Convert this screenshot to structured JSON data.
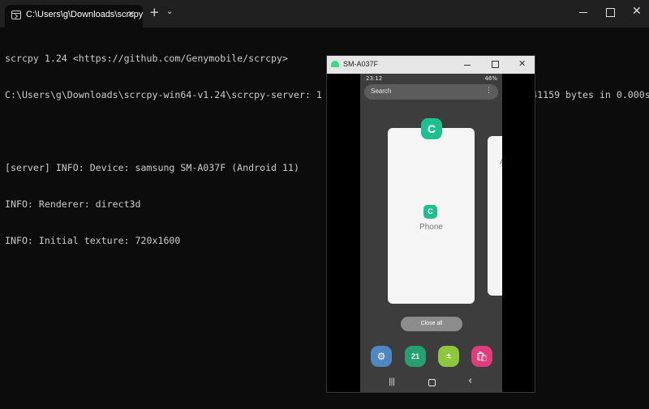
{
  "terminal": {
    "tab_title": "C:\\Users\\g\\Downloads\\scrcpy",
    "lines": [
      "scrcpy 1.24 <https://github.com/Genymobile/scrcpy>",
      "C:\\Users\\g\\Downloads\\scrcpy-win64-v1.24\\scrcpy-server: 1 file pushed, 0 skipped. 108.3 MB/s (41159 bytes in 0.000s)",
      "",
      "[server] INFO: Device: samsung SM-A037F (Android 11)",
      "INFO: Renderer: direct3d",
      "INFO: Initial texture: 720x1600"
    ]
  },
  "scrcpy_window": {
    "title": "SM-A037F"
  },
  "phone": {
    "status_time": "23:12",
    "status_battery": "46%",
    "search_placeholder": "Search",
    "recent_app_label": "Phone",
    "second_card_text": "A",
    "close_all_label": "Close all",
    "calendar_day": "21",
    "dock_apps": [
      "settings-icon",
      "calendar-icon",
      "calculator-icon",
      "galaxy-store-icon"
    ]
  },
  "colors": {
    "terminal_bg": "#0c0c0c",
    "terminal_text": "#cccccc",
    "phone_accent": "#1fbf8f"
  }
}
